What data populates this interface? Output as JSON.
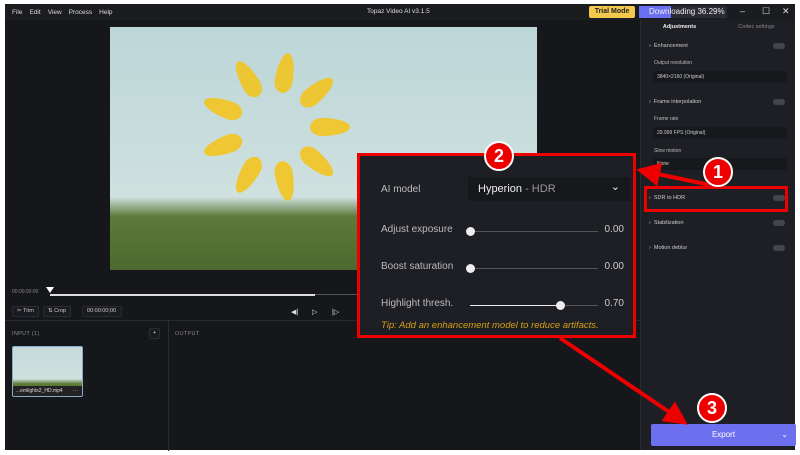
{
  "menu": [
    "File",
    "Edit",
    "View",
    "Process",
    "Help"
  ],
  "app_title": "Topaz Video AI  v3.1.5",
  "trial_label": "Trial Mode",
  "download": {
    "label": "Downloading 36.29%",
    "progress": 36.29
  },
  "timeline": {
    "time": "00:00:00:00",
    "trim": "Trim",
    "crop": "Crop",
    "timecode": "00:00:00;00"
  },
  "input": {
    "label": "INPUT (1)",
    "add": "+",
    "file": "...emlights2_HD.mp4",
    "more": "···"
  },
  "output": {
    "label": "OUTPUT"
  },
  "sidebar": {
    "tabs": [
      "Adjustments",
      "Codec settings"
    ],
    "enhancement": "Enhancement",
    "output_resolution": "Output resolution",
    "resolution_value": "3840×2160 (Original)",
    "frame_interpolation": "Frame interpolation",
    "frame_rate": "Frame rate",
    "frame_rate_value": "29.999 FPS (Original)",
    "slow_motion": "Slow motion",
    "slow_motion_value": "None",
    "sdr_to_hdr": "SDR to HDR",
    "stabilization": "Stabilization",
    "motion_deblur": "Motion deblur",
    "export": "Export"
  },
  "popup": {
    "ai_model_label": "AI model",
    "ai_model_name": "Hyperion",
    "ai_model_suffix": " - HDR",
    "sliders": [
      {
        "label": "Adjust exposure",
        "value": "0.00",
        "fraction": 0.0
      },
      {
        "label": "Boost saturation",
        "value": "0.00",
        "fraction": 0.0
      },
      {
        "label": "Highlight thresh.",
        "value": "0.70",
        "fraction": 0.7
      }
    ],
    "tip": "Tip: Add an enhancement model to reduce artifacts."
  },
  "annotations": [
    "1",
    "2",
    "3"
  ]
}
